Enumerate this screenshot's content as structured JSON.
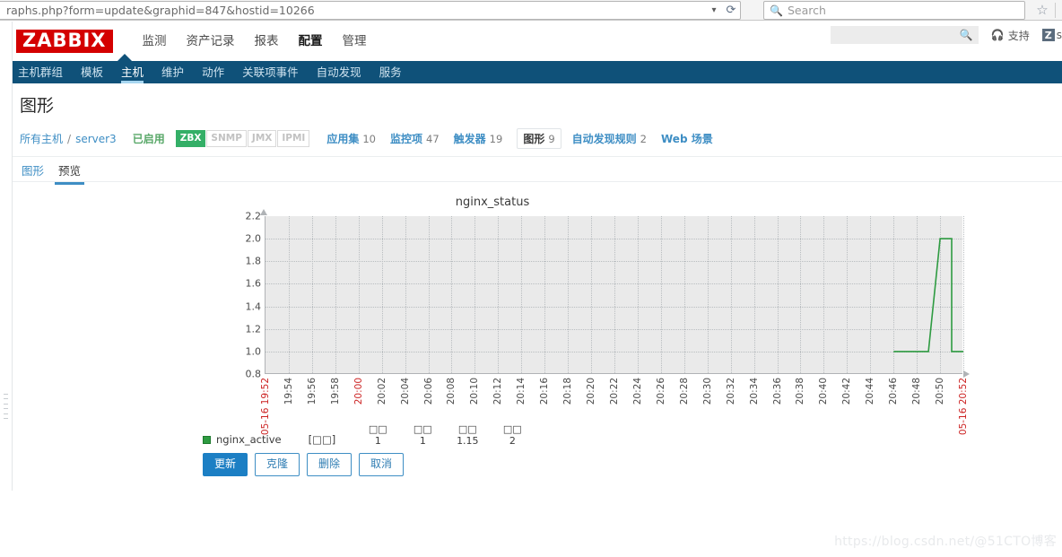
{
  "browser": {
    "url": "raphs.php?form=update&graphid=847&hostid=10266",
    "url_chevron": "chevron-down",
    "reload_glyph": "⟳",
    "search_placeholder": "Search",
    "search_icon": "search-icon",
    "bookmark_icon": "star-icon"
  },
  "header": {
    "logo": "ZABBIX",
    "nav": [
      {
        "label": "监测",
        "selected": false
      },
      {
        "label": "资产记录",
        "selected": false
      },
      {
        "label": "报表",
        "selected": false
      },
      {
        "label": "配置",
        "selected": true
      },
      {
        "label": "管理",
        "selected": false
      }
    ],
    "search_value": "",
    "support_label": "支持",
    "support_icon": "headset-icon",
    "share_icon": "Z",
    "share_label": "s"
  },
  "subnav": [
    {
      "label": "主机群组",
      "selected": false
    },
    {
      "label": "模板",
      "selected": false
    },
    {
      "label": "主机",
      "selected": true
    },
    {
      "label": "维护",
      "selected": false
    },
    {
      "label": "动作",
      "selected": false
    },
    {
      "label": "关联项事件",
      "selected": false
    },
    {
      "label": "自动发现",
      "selected": false
    },
    {
      "label": "服务",
      "selected": false
    }
  ],
  "page": {
    "title": "图形",
    "breadcrumb": {
      "all_hosts": "所有主机",
      "separator": "/",
      "host": "server3",
      "status": "已启用",
      "interfaces": [
        {
          "label": "ZBX",
          "active": true
        },
        {
          "label": "SNMP",
          "active": false
        },
        {
          "label": "JMX",
          "active": false
        },
        {
          "label": "IPMI",
          "active": false
        }
      ],
      "links": [
        {
          "label": "应用集",
          "count": "10",
          "selected": false
        },
        {
          "label": "监控项",
          "count": "47",
          "selected": false
        },
        {
          "label": "触发器",
          "count": "19",
          "selected": false
        },
        {
          "label": "图形",
          "count": "9",
          "selected": true
        },
        {
          "label": "自动发现规则",
          "count": "2",
          "selected": false
        },
        {
          "label": "Web 场景",
          "count": "",
          "selected": false
        }
      ]
    },
    "tabs": [
      {
        "label": "图形",
        "active": false
      },
      {
        "label": "预览",
        "active": true
      }
    ]
  },
  "chart_data": {
    "type": "line",
    "title": "nginx_status",
    "xlabel": "",
    "ylabel": "",
    "ylim": [
      0.8,
      2.2
    ],
    "yticks": [
      2.2,
      2.0,
      1.8,
      1.6,
      1.4,
      1.2,
      1.0,
      0.8
    ],
    "grid": true,
    "legend_position": "bottom-left",
    "xticks": [
      {
        "label": "05-16 19:52",
        "red": true
      },
      {
        "label": "19:54",
        "red": false
      },
      {
        "label": "19:56",
        "red": false
      },
      {
        "label": "19:58",
        "red": false
      },
      {
        "label": "20:00",
        "red": true
      },
      {
        "label": "20:02",
        "red": false
      },
      {
        "label": "20:04",
        "red": false
      },
      {
        "label": "20:06",
        "red": false
      },
      {
        "label": "20:08",
        "red": false
      },
      {
        "label": "20:10",
        "red": false
      },
      {
        "label": "20:12",
        "red": false
      },
      {
        "label": "20:14",
        "red": false
      },
      {
        "label": "20:16",
        "red": false
      },
      {
        "label": "20:18",
        "red": false
      },
      {
        "label": "20:20",
        "red": false
      },
      {
        "label": "20:22",
        "red": false
      },
      {
        "label": "20:24",
        "red": false
      },
      {
        "label": "20:26",
        "red": false
      },
      {
        "label": "20:28",
        "red": false
      },
      {
        "label": "20:30",
        "red": false
      },
      {
        "label": "20:32",
        "red": false
      },
      {
        "label": "20:34",
        "red": false
      },
      {
        "label": "20:36",
        "red": false
      },
      {
        "label": "20:38",
        "red": false
      },
      {
        "label": "20:40",
        "red": false
      },
      {
        "label": "20:42",
        "red": false
      },
      {
        "label": "20:44",
        "red": false
      },
      {
        "label": "20:46",
        "red": false
      },
      {
        "label": "20:48",
        "red": false
      },
      {
        "label": "20:50",
        "red": false
      },
      {
        "label": "05-16 20:52",
        "red": true
      }
    ],
    "series": [
      {
        "name": "nginx_active",
        "color": "#2e9b41",
        "points": [
          {
            "x": "20:46",
            "y": 1
          },
          {
            "x": "20:49",
            "y": 1
          },
          {
            "x": "20:50",
            "y": 2
          },
          {
            "x": "20:51",
            "y": 2
          },
          {
            "x": "20:51",
            "y": 1
          },
          {
            "x": "20:52",
            "y": 1
          }
        ]
      }
    ],
    "legend": {
      "name": "nginx_active",
      "unit": "[□□]",
      "columns": [
        {
          "header": "□□",
          "value": "1"
        },
        {
          "header": "□□",
          "value": "1"
        },
        {
          "header": "□□",
          "value": "1.15"
        },
        {
          "header": "□□",
          "value": "2"
        }
      ]
    }
  },
  "buttons": [
    {
      "label": "更新",
      "primary": true
    },
    {
      "label": "克隆",
      "primary": false
    },
    {
      "label": "删除",
      "primary": false
    },
    {
      "label": "取消",
      "primary": false
    }
  ],
  "watermark": "https://blog.csdn.net/@51CTO博客"
}
